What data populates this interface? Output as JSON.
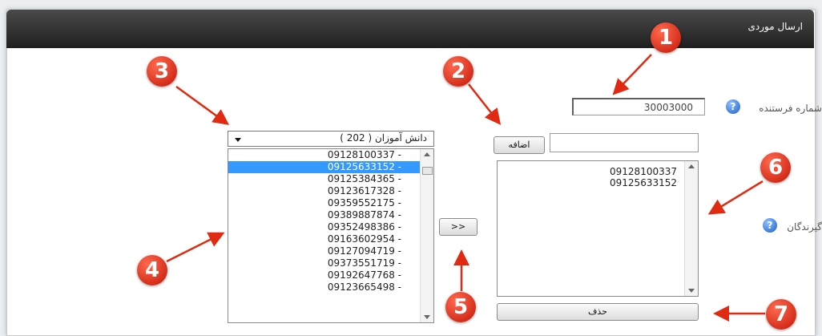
{
  "window": {
    "title": "ارسال موردی"
  },
  "sender": {
    "label": "شماره فرستنده",
    "value": "30003000"
  },
  "add": {
    "input_value": "",
    "button_label": "اضافه"
  },
  "recipients": {
    "label": "گیرندگان",
    "items": [
      "09128100337",
      "09125633152"
    ],
    "delete_label": "حذف"
  },
  "group_select": {
    "selected": "دانش آموزان ( 202 )"
  },
  "contacts": {
    "selected_index": 1,
    "items": [
      "09128100337 -",
      "09125633152 -",
      "09125384365 -",
      "09123617328 -",
      "09359552175 -",
      "09389887874 -",
      "09352498386 -",
      "09163602954 -",
      "09127094719 -",
      "09373551719 -",
      "09192647768 -",
      "09123665498 -"
    ]
  },
  "transfer_button": {
    "label": ">>"
  },
  "help_icon": {
    "icon": "question-help-icon",
    "text": "?"
  },
  "callouts": [
    "1",
    "2",
    "3",
    "4",
    "5",
    "6",
    "7"
  ],
  "colors": {
    "callout": "#d9230f",
    "selection": "#3399ff",
    "header": "#2b2b2b"
  }
}
